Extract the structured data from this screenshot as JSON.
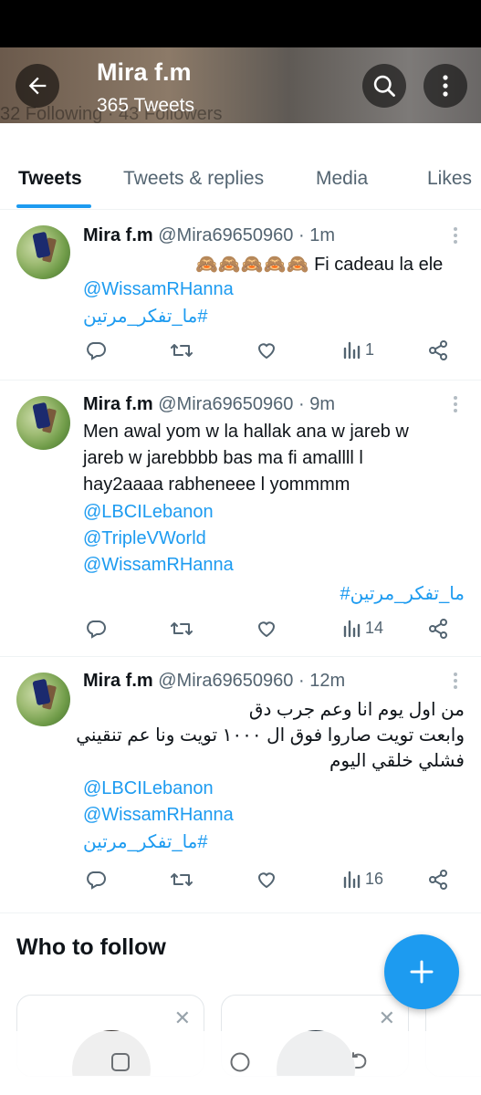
{
  "header": {
    "title": "Mira f.m",
    "subtitle": "365 Tweets",
    "ghost_stats": "32 Following · 43 Followers"
  },
  "tabs": [
    "Tweets",
    "Tweets & replies",
    "Media",
    "Likes"
  ],
  "tweets": [
    {
      "name": "Mira f.m",
      "handle": "@Mira69650960",
      "time": "1m",
      "emoji": "🙈🙈🙈🙈🙈",
      "text": "Fi cadeau la ele",
      "mention1": "@WissamRHanna",
      "hashtag": "#ما_تفكر_مرتين",
      "views": "1"
    },
    {
      "name": "Mira f.m",
      "handle": "@Mira69650960",
      "time": "9m",
      "lines": [
        "Men awal yom w la hallak ana w jareb w",
        "jareb w jarebbbb bas ma fi amallll l",
        "hay2aaaa rabheneee l yommmm"
      ],
      "mentions": [
        "@LBCILebanon",
        "@TripleVWorld",
        "@WissamRHanna"
      ],
      "hashtag": "#ما_تفكر_مرتين",
      "views": "14"
    },
    {
      "name": "Mira f.m",
      "handle": "@Mira69650960",
      "time": "12m",
      "lines": [
        "من اول يوم انا وعم جرب دق",
        "وابعت تويت صاروا فوق ال ١٠٠٠ تويت ونا عم تنقيني",
        "فشلي خلقي اليوم"
      ],
      "mentions": [
        "@LBCILebanon",
        "@WissamRHanna"
      ],
      "hashtag": "#ما_تفكر_مرتين",
      "views": "16"
    }
  ],
  "who_to_follow": {
    "title": "Who to follow"
  },
  "colors": {
    "accent": "#1d9bf0",
    "secondary_text": "#536471"
  },
  "icons": [
    "back-arrow-icon",
    "search-icon",
    "more-vertical-icon",
    "reply-icon",
    "retweet-icon",
    "like-icon",
    "views-icon",
    "share-icon",
    "plus-icon",
    "close-icon",
    "recents-icon",
    "home-icon",
    "back-icon"
  ]
}
